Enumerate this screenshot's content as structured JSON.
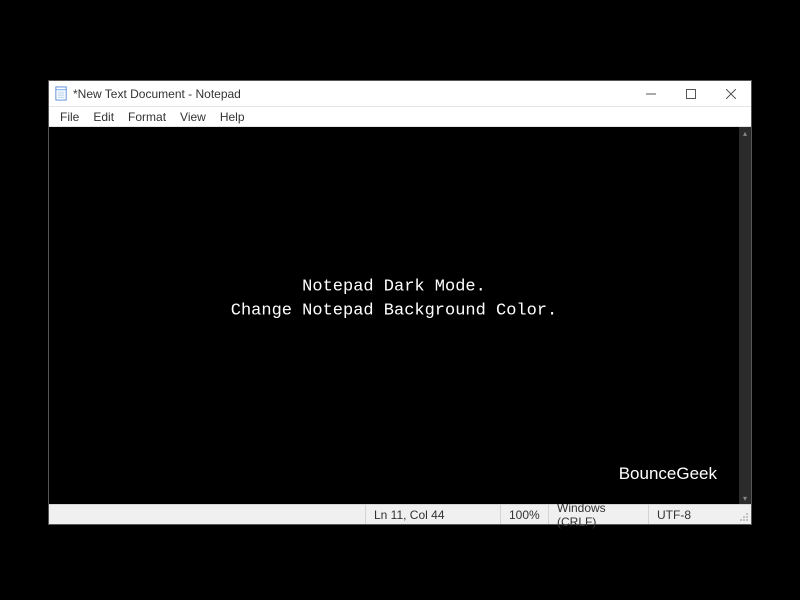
{
  "window": {
    "title": "*New Text Document - Notepad"
  },
  "menu": {
    "file": "File",
    "edit": "Edit",
    "format": "Format",
    "view": "View",
    "help": "Help"
  },
  "editor": {
    "line1": "Notepad Dark Mode.",
    "line2": "Change Notepad Background Color.",
    "watermark": "BounceGeek"
  },
  "status": {
    "position": "Ln 11, Col 44",
    "zoom": "100%",
    "line_ending": "Windows (CRLF)",
    "encoding": "UTF-8"
  }
}
